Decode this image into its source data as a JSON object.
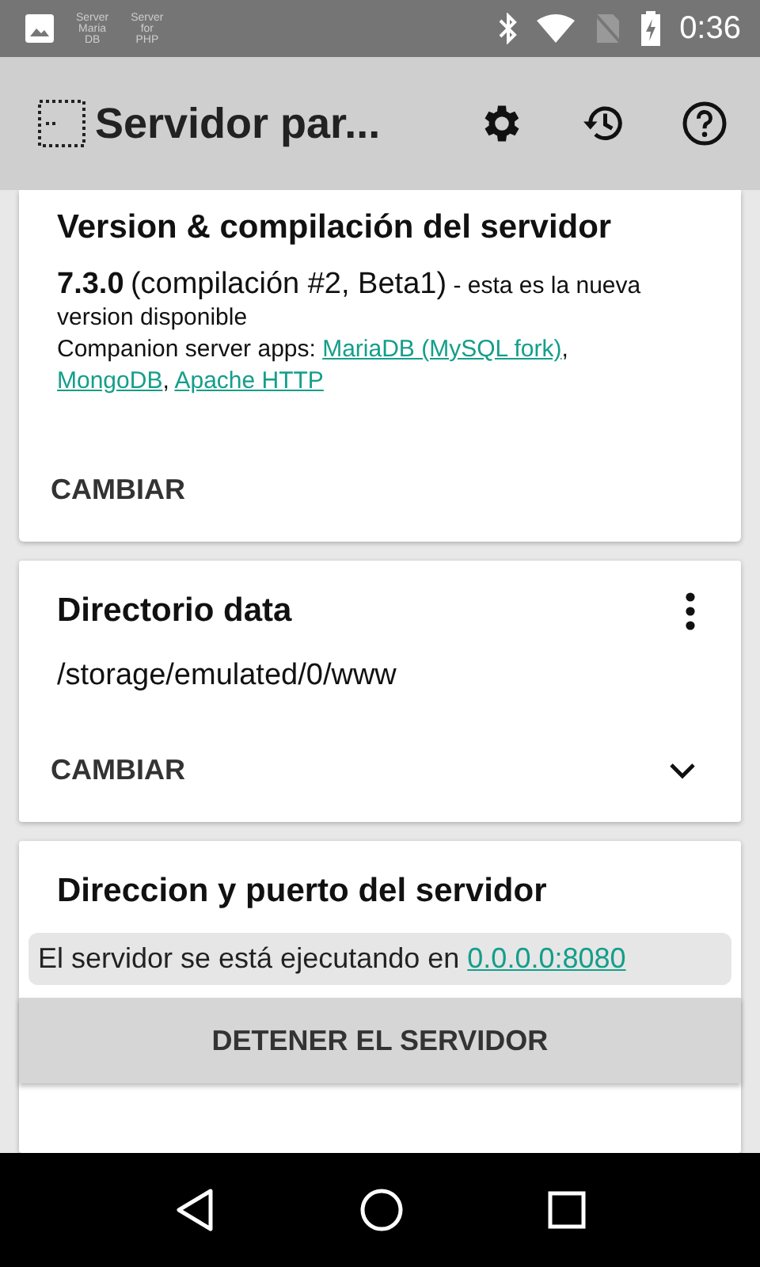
{
  "status_bar": {
    "notifications": [
      {
        "kind": "image"
      },
      {
        "kind": "text",
        "lines": [
          "Server",
          "Maria",
          "DB"
        ]
      },
      {
        "kind": "text",
        "lines": [
          "Server",
          "for",
          "PHP"
        ]
      }
    ],
    "time": "0:36"
  },
  "app_bar": {
    "title": "Servidor par..."
  },
  "version_card": {
    "title": "Version & compilación del servidor",
    "version": "7.3.0",
    "build": "(compilación #2, Beta1)",
    "note": "- esta es la nueva version disponible",
    "companion_label": "Companion server apps:",
    "companion_links": [
      {
        "text": "MariaDB (MySQL fork)",
        "after": ","
      },
      {
        "text": "MongoDB",
        "after": ","
      },
      {
        "text": "Apache HTTP"
      }
    ],
    "action": "CAMBIAR"
  },
  "data_card": {
    "title": "Directorio data",
    "path": "/storage/emulated/0/www",
    "action": "CAMBIAR",
    "expanded": false
  },
  "server_card": {
    "title": "Direccion y puerto del servidor",
    "status": "El servidor se está ejecutando en",
    "address": "0.0.0.0:8080",
    "running": true,
    "button": "DETENER EL SERVIDOR"
  }
}
